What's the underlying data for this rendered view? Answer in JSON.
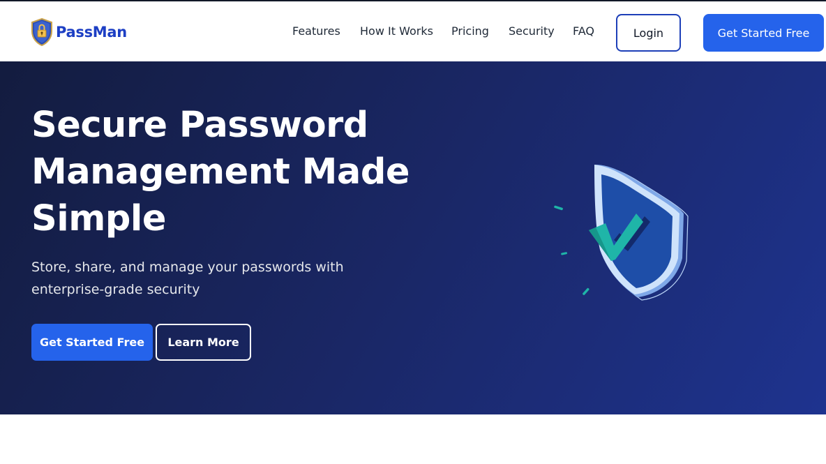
{
  "header": {
    "brand_name": "PassMan",
    "logo_icon": "shield-lock-icon",
    "nav": [
      {
        "label": "Features"
      },
      {
        "label": "How It Works"
      },
      {
        "label": "Pricing"
      },
      {
        "label": "Security"
      },
      {
        "label": "FAQ"
      }
    ],
    "login_label": "Login",
    "cta_label": "Get Started Free"
  },
  "hero": {
    "title_lines": [
      "Secure Password",
      "Management Made",
      "Simple"
    ],
    "subtitle_lines": [
      "Store, share, and manage your passwords with",
      "enterprise-grade security"
    ],
    "primary_button": "Get Started Free",
    "secondary_button": "Learn More",
    "illustration_icon": "shield-check-icon"
  },
  "colors": {
    "brand_blue": "#2563eb",
    "brand_text": "#1d3fc4",
    "hero_dark": "#131c3f",
    "hero_mid": "#1a2766",
    "accent_teal": "#1fb5a8"
  }
}
